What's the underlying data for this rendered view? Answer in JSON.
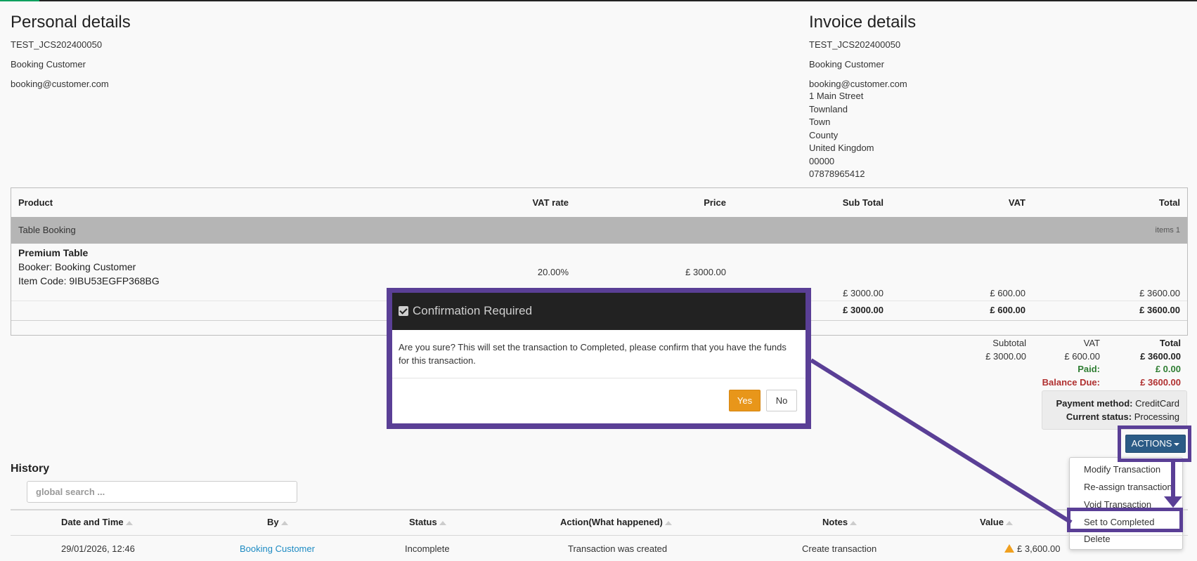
{
  "personal": {
    "title": "Personal details",
    "ref": "TEST_JCS202400050",
    "name": "Booking Customer",
    "email": "booking@customer.com"
  },
  "invoice": {
    "title": "Invoice details",
    "ref": "TEST_JCS202400050",
    "name": "Booking Customer",
    "email": "booking@customer.com",
    "address": [
      "1 Main Street",
      "Townland",
      "Town",
      "County",
      "United Kingdom",
      "00000",
      "07878965412"
    ]
  },
  "products": {
    "headers": {
      "product": "Product",
      "vat_rate": "VAT rate",
      "price": "Price",
      "sub_total": "Sub Total",
      "vat": "VAT",
      "total": "Total"
    },
    "group": {
      "label": "Table Booking",
      "items": "items 1"
    },
    "item": {
      "title": "Premium Table",
      "booker": "Booker: Booking Customer",
      "code": "Item Code:  9IBU53EGFP368BG",
      "vat_rate": "20.00%",
      "price": "£ 3000.00",
      "sub_total": "£ 3000.00",
      "vat": "£ 600.00",
      "total": "£ 3600.00"
    },
    "group_total": {
      "sub_total": "£ 3000.00",
      "vat": "£ 600.00",
      "total": "£ 3600.00"
    }
  },
  "totals": {
    "subtotal_label": "Subtotal",
    "vat_label": "VAT",
    "total_label": "Total",
    "subtotal": "£ 3000.00",
    "vat": "£ 600.00",
    "total": "£ 3600.00",
    "paid_label": "Paid:",
    "paid": "£ 0.00",
    "balance_label": "Balance Due:",
    "balance": "£ 3600.00"
  },
  "payment": {
    "method_label": "Payment method:",
    "method": "CreditCard",
    "status_label": "Current status:",
    "status": "Processing"
  },
  "actions": {
    "label": "ACTIONS",
    "menu": [
      "Modify Transaction",
      "Re-assign transaction",
      "Void Transaction",
      "Set to Completed",
      "Delete"
    ]
  },
  "history": {
    "title": "History",
    "search_placeholder": "global search ...",
    "columns": [
      "Date and Time",
      "By",
      "Status",
      "Action(What happened)",
      "Notes",
      "Value"
    ],
    "rows": [
      {
        "datetime": "29/01/2026, 12:46",
        "by": "Booking Customer",
        "status": "Incomplete",
        "action": "Transaction was created",
        "notes": "Create transaction",
        "value": "£ 3,600.00"
      }
    ]
  },
  "modal": {
    "title": "Confirmation Required",
    "message": "Are you sure? This will set the transaction to Completed, please confirm that you have the funds for this transaction.",
    "yes": "Yes",
    "no": "No"
  },
  "colors": {
    "annotation": "#5a3f96",
    "primary_button": "#2b5b86",
    "confirm_button": "#e8961a",
    "paid": "#2e7d32",
    "balance_due": "#b03030",
    "link": "#1e8bc3"
  }
}
